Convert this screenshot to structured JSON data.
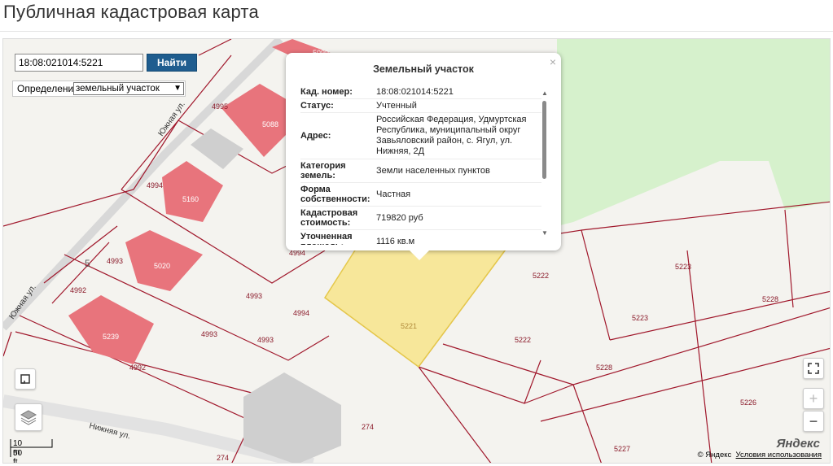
{
  "page": {
    "title": "Публичная кадастровая карта"
  },
  "search": {
    "value": "18:08:021014:5221",
    "button_label": "Найти"
  },
  "definition": {
    "label": "Определение:",
    "selected": "земельный участок"
  },
  "popup": {
    "title": "Земельный участок",
    "close": "×",
    "rows": [
      {
        "label": "Кад. номер:",
        "value": "18:08:021014:5221"
      },
      {
        "label": "Статус:",
        "value": "Учтенный"
      },
      {
        "label": "Адрес:",
        "value": "Российская Федерация, Удмуртская Республика, муниципальный округ Завьяловский район, с. Ягул, ул. Нижняя, 2Д"
      },
      {
        "label": "Категория земель:",
        "value": "Земли населенных пунктов"
      },
      {
        "label": "Форма собственности:",
        "value": "Частная"
      },
      {
        "label": "Кадастровая стоимость:",
        "value": "719820 руб"
      },
      {
        "label": "Уточненная площадь:",
        "value": "1116 кв.м"
      }
    ]
  },
  "map_labels": {
    "parcels": [
      "4995",
      "5088",
      "4994",
      "5160",
      "4993",
      "5020",
      "4992",
      "5239",
      "4993",
      "4993",
      "4994",
      "4994",
      "4993",
      "4992",
      "5221",
      "5222",
      "5222",
      "5223",
      "5223",
      "5228",
      "5228",
      "5226",
      "5227",
      "274",
      "274",
      "5",
      "5099"
    ],
    "streets": [
      "Южная ул.",
      "Нижняя ул.",
      "Южная ул."
    ]
  },
  "scale": {
    "metric": "10 m",
    "imperial": "50 ft"
  },
  "attribution": {
    "copyright": "© Яндекс",
    "terms": "Условия использования",
    "logo": "Яндекс"
  },
  "controls": {
    "zoom_in": "+",
    "zoom_out": "−"
  },
  "colors": {
    "selected_parcel": "#f7e79a",
    "building": "#e8747c",
    "forest": "#d3f0c8",
    "boundary": "#a0172b"
  }
}
